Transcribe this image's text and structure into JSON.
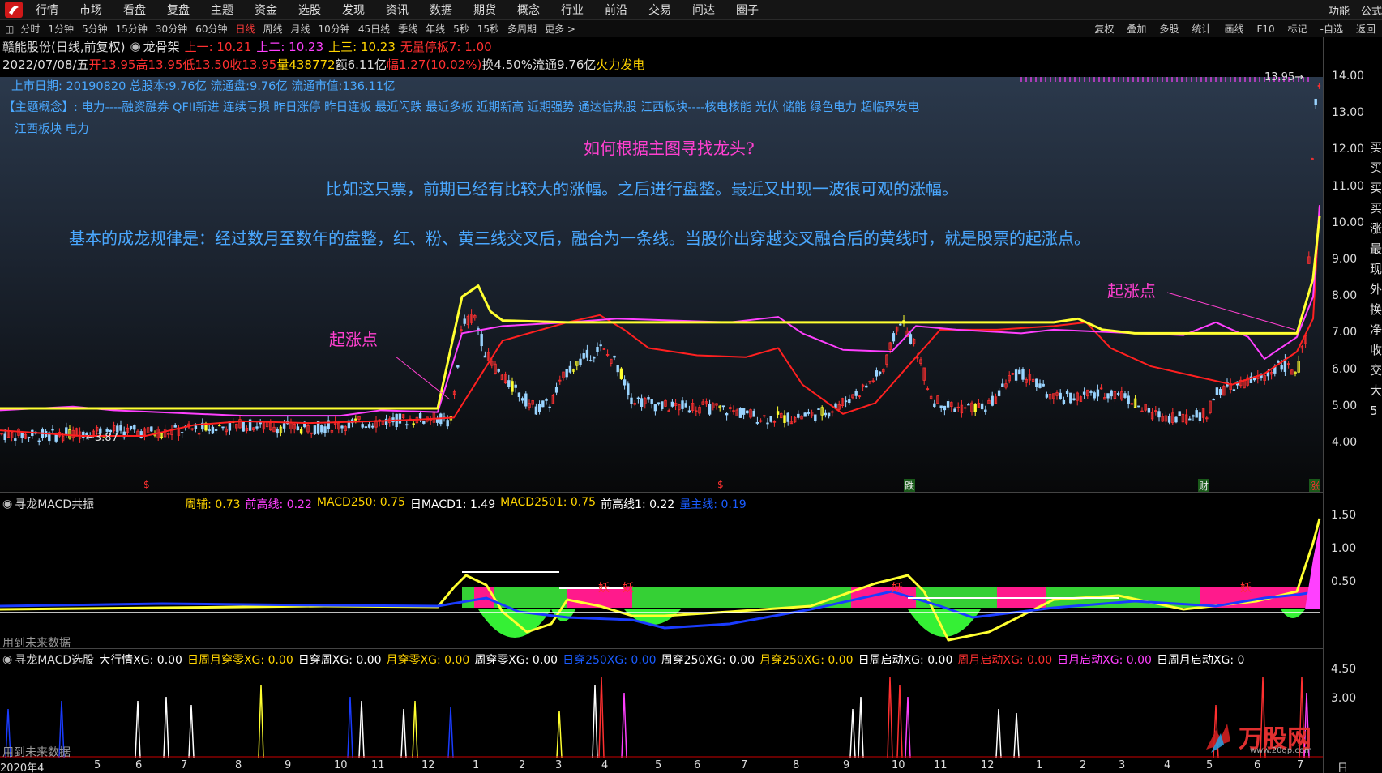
{
  "menu": [
    "行情",
    "市场",
    "看盘",
    "复盘",
    "主题",
    "资金",
    "选股",
    "发现",
    "资讯",
    "数据",
    "期货",
    "概念",
    "行业",
    "前沿",
    "交易",
    "问达",
    "圈子"
  ],
  "menu_right": [
    "功能",
    "公式"
  ],
  "periods": [
    "分时",
    "1分钟",
    "5分钟",
    "15分钟",
    "30分钟",
    "60分钟",
    "日线",
    "周线",
    "月线",
    "10分钟",
    "45日线",
    "季线",
    "年线",
    "5秒",
    "15秒",
    "多周期",
    "更多 >"
  ],
  "active_period": "日线",
  "tools": [
    "复权",
    "叠加",
    "多股",
    "统计",
    "画线",
    "F10",
    "标记",
    "-自选",
    "返回"
  ],
  "stock": {
    "name": "赣能股份(日线,前复权)",
    "indicator": "龙骨架",
    "up1": "上一: 10.21",
    "up2": "上二: 10.23",
    "up3": "上三: 10.23",
    "limit": "无量停板7: 1.00",
    "date": "2022/07/08/五",
    "open": "开13.95",
    "high": "高13.95",
    "low": "低13.50",
    "close": "收13.95",
    "vol": "量438772",
    "amount": "额6.11亿",
    "change": "幅1.27(10.02%)",
    "turnover": "换4.50%",
    "float_cap": "流通9.76亿",
    "concept": "火力发电"
  },
  "info": {
    "line1": "上市日期: 20190820  总股本:9.76亿      流通盘:9.76亿         流通市值:136.11亿",
    "line2": "【主题概念】: 电力----融资融券 QFII新进 连续亏损 昨日涨停 昨日连板 最近闪跌 最近多板 近期新高 近期强势 通达信热股 江西板块----核电核能 光伏 储能 绿色电力 超临界发电",
    "line3": "江西板块 电力"
  },
  "annotations": {
    "question": "如何根据主图寻找龙头?",
    "para1": "比如这只票，前期已经有比较大的涨幅。之后进行盘整。最近又出现一波很可观的涨幅。",
    "para2": "基本的成龙规律是：经过数月至数年的盘整，红、粉、黄三线交叉后，融合为一条线。当股价出穿越交叉融合后的黄线时，就是股票的起涨点。",
    "start_point": "起涨点"
  },
  "price_axis": [
    "14.00",
    "13.00",
    "12.00",
    "11.00",
    "10.00",
    "9.00",
    "8.00",
    "7.00",
    "6.00",
    "5.00",
    "4.00"
  ],
  "low_mark": "←3.87",
  "high_mark": "13.95→",
  "markers": [
    "$",
    "$",
    "跌",
    "财",
    "涨"
  ],
  "panel1": {
    "title": "寻龙MACD共振",
    "items": [
      {
        "label": "周辅: 0.73",
        "color": "#ffd400"
      },
      {
        "label": "前高线: 0.22",
        "color": "#ff40ff"
      },
      {
        "label": "MACD250: 0.75",
        "color": "#ffd400"
      },
      {
        "label": "日MACD1: 1.49",
        "color": "#ffffff"
      },
      {
        "label": "MACD2501: 0.75",
        "color": "#ffd400"
      },
      {
        "label": "前高线1: 0.22",
        "color": "#ffffff"
      },
      {
        "label": "量主线: 0.19",
        "color": "#1a5cff"
      }
    ],
    "axis": [
      "1.50",
      "1.00",
      "0.50"
    ],
    "demon": "妖",
    "future": "用到未来数据"
  },
  "panel2": {
    "title": "寻龙MACD选股",
    "items": [
      {
        "label": "大行情XG: 0.00",
        "color": "#ffffff"
      },
      {
        "label": "日周月穿零XG: 0.00",
        "color": "#ffd400"
      },
      {
        "label": "日穿周XG: 0.00",
        "color": "#ffffff"
      },
      {
        "label": "月穿零XG: 0.00",
        "color": "#ffd400"
      },
      {
        "label": "周穿零XG: 0.00",
        "color": "#ffffff"
      },
      {
        "label": "日穿250XG: 0.00",
        "color": "#1a5cff"
      },
      {
        "label": "周穿250XG: 0.00",
        "color": "#ffffff"
      },
      {
        "label": "月穿250XG: 0.00",
        "color": "#ffd400"
      },
      {
        "label": "日周启动XG: 0.00",
        "color": "#ffffff"
      },
      {
        "label": "周月启动XG: 0.00",
        "color": "#ff3030"
      },
      {
        "label": "日月启动XG: 0.00",
        "color": "#ff40ff"
      },
      {
        "label": "日周月启动XG: 0",
        "color": "#ffffff"
      }
    ],
    "axis": [
      "4.50",
      "3.00"
    ],
    "future": "用到未来数据"
  },
  "xaxis": [
    "2020年4",
    "5",
    "6",
    "7",
    "8",
    "9",
    "10",
    "11",
    "12",
    "1",
    "2",
    "3",
    "4",
    "5",
    "6",
    "7",
    "8",
    "9",
    "10",
    "11",
    "12",
    "1",
    "2",
    "3",
    "4",
    "5",
    "6",
    "7"
  ],
  "xaxis_end": "日线",
  "right_col": "买买买买涨最现外换净收交大5",
  "watermark": {
    "brand": "万股网",
    "url": "www.20gp.com"
  },
  "colors": {
    "red_line": "#ff2020",
    "pink_line": "#ff40ff",
    "yellow_line": "#ffff30",
    "candle_up": "#ff3030",
    "candle_down": "#9ad4ff",
    "text_blue": "#4aa8ff",
    "annot_magenta": "#ff40d0"
  }
}
